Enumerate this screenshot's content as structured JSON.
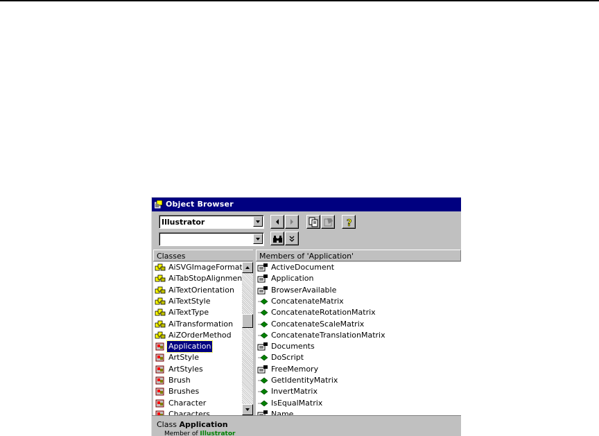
{
  "window": {
    "title": "Object Browser",
    "library_value": "Illustrator",
    "search_value": ""
  },
  "toolbar": {
    "buttons": [
      "back-button",
      "forward-button",
      "copy-button",
      "view-definition-button",
      "help-button",
      "search-button",
      "toggle-search-results-button"
    ]
  },
  "classes": {
    "header": "Classes",
    "items": [
      {
        "label": "AiSVGImageFormat",
        "icon": "enum-icon"
      },
      {
        "label": "AiTabStopAlignment",
        "icon": "enum-icon"
      },
      {
        "label": "AiTextOrientation",
        "icon": "enum-icon"
      },
      {
        "label": "AiTextStyle",
        "icon": "enum-icon"
      },
      {
        "label": "AiTextType",
        "icon": "enum-icon"
      },
      {
        "label": "AiTransformation",
        "icon": "enum-icon"
      },
      {
        "label": "AiZOrderMethod",
        "icon": "enum-icon"
      },
      {
        "label": "Application",
        "icon": "class-icon",
        "selected": true
      },
      {
        "label": "ArtStyle",
        "icon": "class-icon"
      },
      {
        "label": "ArtStyles",
        "icon": "class-icon"
      },
      {
        "label": "Brush",
        "icon": "class-icon"
      },
      {
        "label": "Brushes",
        "icon": "class-icon"
      },
      {
        "label": "Character",
        "icon": "class-icon"
      },
      {
        "label": "Characters",
        "icon": "class-icon"
      }
    ]
  },
  "members": {
    "header": "Members of 'Application'",
    "items": [
      {
        "label": "ActiveDocument",
        "icon": "property-icon"
      },
      {
        "label": "Application",
        "icon": "property-icon"
      },
      {
        "label": "BrowserAvailable",
        "icon": "property-icon"
      },
      {
        "label": "ConcatenateMatrix",
        "icon": "method-icon"
      },
      {
        "label": "ConcatenateRotationMatrix",
        "icon": "method-icon"
      },
      {
        "label": "ConcatenateScaleMatrix",
        "icon": "method-icon"
      },
      {
        "label": "ConcatenateTranslationMatrix",
        "icon": "method-icon"
      },
      {
        "label": "Documents",
        "icon": "property-icon"
      },
      {
        "label": "DoScript",
        "icon": "method-icon"
      },
      {
        "label": "FreeMemory",
        "icon": "property-icon"
      },
      {
        "label": "GetIdentityMatrix",
        "icon": "method-icon"
      },
      {
        "label": "InvertMatrix",
        "icon": "method-icon"
      },
      {
        "label": "IsEqualMatrix",
        "icon": "method-icon"
      },
      {
        "label": "Name",
        "icon": "property-icon"
      }
    ]
  },
  "details": {
    "prefix": "Class ",
    "name": "Application",
    "member_of_prefix": "Member of ",
    "member_of": "Illustrator"
  },
  "colors": {
    "titlebar": "#000080",
    "selection": "#000080",
    "member_of_link": "#008000"
  }
}
